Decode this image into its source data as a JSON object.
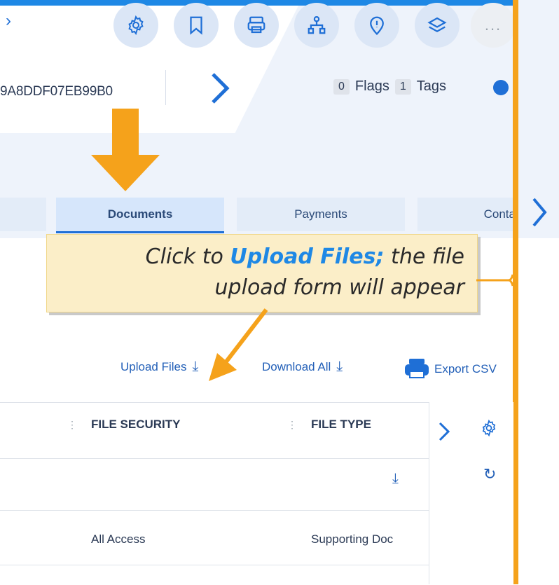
{
  "header": {
    "record_id": "9A8DDF07EB99B0",
    "flags_count": "0",
    "flags_label": "Flags",
    "tags_count": "1",
    "tags_label": "Tags"
  },
  "toolbar": {
    "icons": [
      "settings-icon",
      "bookmark-icon",
      "print-icon",
      "hierarchy-icon",
      "location-icon",
      "layers-icon",
      "more-icon"
    ],
    "more_label": "..."
  },
  "tabs": [
    {
      "label": "",
      "active": false
    },
    {
      "label": "Documents",
      "active": true
    },
    {
      "label": "Payments",
      "active": false
    },
    {
      "label": "Conta",
      "active": false
    }
  ],
  "callout": {
    "line1_prefix": "Click to ",
    "line1_highlight": "Upload Files;",
    "line1_suffix": " the file",
    "line2": "upload form will appear"
  },
  "actions": {
    "upload_label": "Upload Files",
    "download_label": "Download All",
    "export_label": "Export CSV"
  },
  "grid": {
    "columns": [
      "FILE SECURITY",
      "FILE TYPE"
    ],
    "rows": [
      {
        "file_security": "All Access",
        "file_type": "Supporting Doc"
      }
    ]
  },
  "colors": {
    "accent": "#1f6fd6",
    "annotation_orange": "#f5a21b",
    "callout_bg": "#fbeec8"
  }
}
